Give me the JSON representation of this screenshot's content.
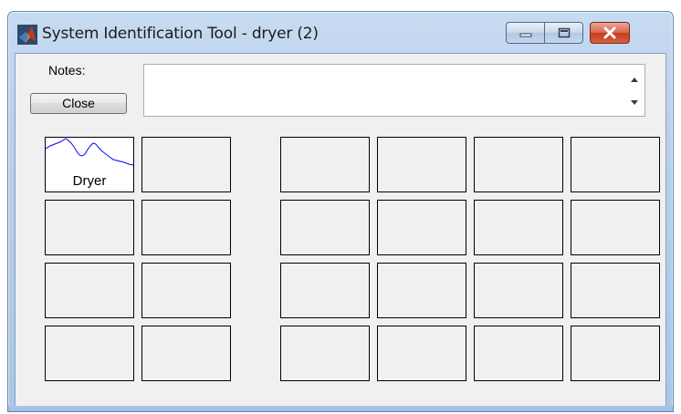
{
  "window": {
    "title": "System Identification Tool - dryer (2)",
    "icon": "matlab-logo-icon",
    "controls": {
      "minimize_icon": "minimize-icon",
      "maximize_icon": "maximize-icon",
      "close_icon": "close-x-icon",
      "close_color": "#c63d22"
    }
  },
  "notes": {
    "label": "Notes:",
    "value": "",
    "scroll_up_icon": "scroll-up-arrow-icon",
    "scroll_down_icon": "scroll-down-arrow-icon"
  },
  "close_button": {
    "label": "Close"
  },
  "data_board": {
    "tiles": [
      {
        "label": "Dryer",
        "plot_color": "#0000ff",
        "icon": "signal-plot-icon"
      }
    ]
  },
  "colors": {
    "window_frame": "#b9d1ec",
    "client_bg": "#f0f0f0",
    "plot_line": "#0000ff"
  }
}
